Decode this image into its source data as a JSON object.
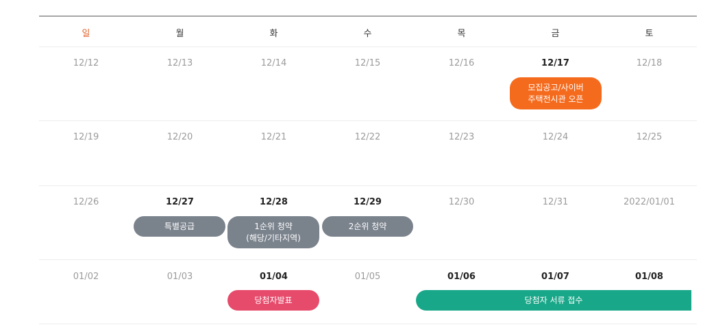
{
  "days": [
    "일",
    "월",
    "화",
    "수",
    "목",
    "금",
    "토"
  ],
  "weeks": [
    {
      "dates": [
        "12/12",
        "12/13",
        "12/14",
        "12/15",
        "12/16",
        "12/17",
        "12/18"
      ]
    },
    {
      "dates": [
        "12/19",
        "12/20",
        "12/21",
        "12/22",
        "12/23",
        "12/24",
        "12/25"
      ]
    },
    {
      "dates": [
        "12/26",
        "12/27",
        "12/28",
        "12/29",
        "12/30",
        "12/31",
        "2022/01/01"
      ]
    },
    {
      "dates": [
        "01/02",
        "01/03",
        "01/04",
        "01/05",
        "01/06",
        "01/07",
        "01/08"
      ]
    }
  ],
  "events": {
    "open": "모집공고/사이버\n주택전시관 오픈",
    "special": "특별공급",
    "first": "1순위 청약\n(해당/기타지역)",
    "second": "2순위 청약",
    "announce": "당첨자발표",
    "docs": "당첨자 서류 접수"
  },
  "colors": {
    "sunday": "#e0622b",
    "open_event": "#f56b1e",
    "subscription_event": "#7a828c",
    "announce_event": "#e74b6c",
    "docs_event": "#18a788"
  }
}
